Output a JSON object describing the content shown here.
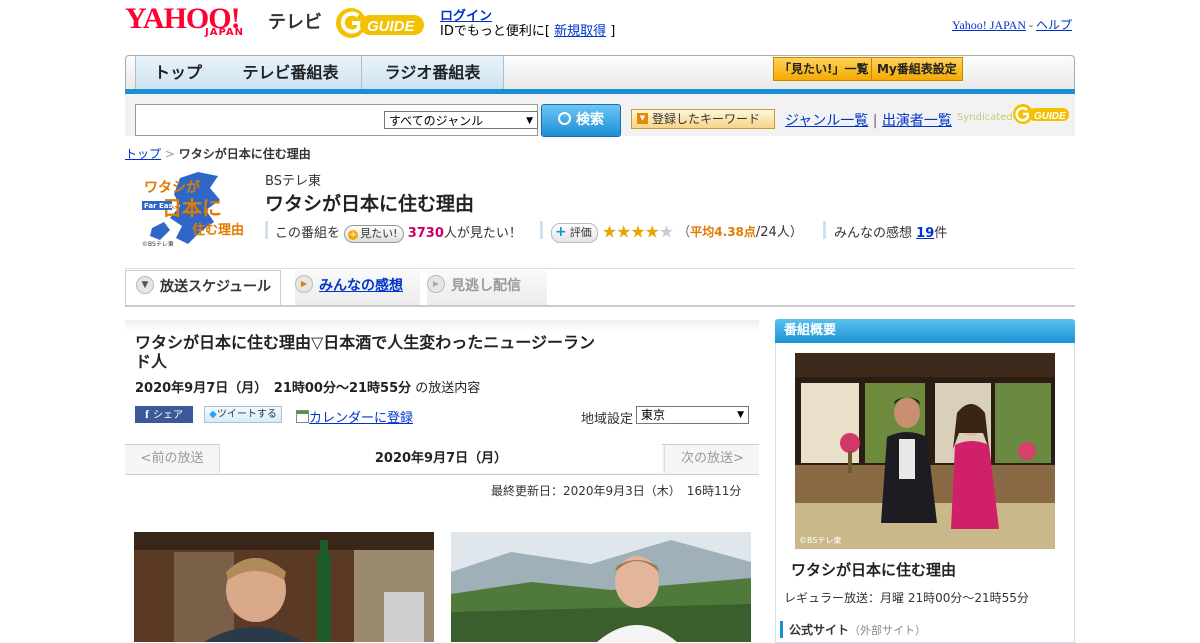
{
  "header": {
    "logo_yahoo": "YAHOO!",
    "logo_japan": "JAPAN",
    "logo_tv": "テレビ",
    "logo_gguide": "GUIDE",
    "login_link": "ログイン",
    "login_sub_prefix": "IDでもっと便利に[",
    "register_link": "新規取得",
    "login_sub_suffix": "]",
    "yahoo_japan_link": "Yahoo! JAPAN",
    "separator": "-",
    "help_link": "ヘルプ"
  },
  "nav": {
    "tabs": [
      "トップ",
      "テレビ番組表",
      "ラジオ番組表"
    ],
    "mitai_list": "「見たい!」一覧",
    "my_schedule": "My番組表設定"
  },
  "search": {
    "genre_selected": "すべてのジャンル",
    "search_button": "検索",
    "keyword_button": "登録したキーワード",
    "genre_list_link": "ジャンル一覧",
    "divider": "|",
    "performer_list_link": "出演者一覧",
    "syndicated": "Syndicated"
  },
  "breadcrumb": {
    "top": "トップ",
    "sep": ">",
    "current": "ワタシが日本に住む理由"
  },
  "program": {
    "logo_line1": "ワタシが",
    "logo_line2": "日本に",
    "logo_line3": "住む理由",
    "logo_far_east": "Far East",
    "logo_copyright": "©BSテレ東",
    "channel": "BSテレ東",
    "title": "ワタシが日本に住む理由",
    "want_prefix": "この番組を",
    "want_button": "見たい!",
    "want_count": "3730",
    "want_suffix": "人が見たい！",
    "rate_button": "評価",
    "rating_stars": 4.38,
    "rating_open": "（",
    "rating_avg": "平均4.38点",
    "rating_count": "/24人）",
    "impressions_prefix": "みんなの感想",
    "impressions_count": "19",
    "impressions_suffix": "件"
  },
  "tabs": {
    "schedule": "放送スケジュール",
    "impressions": "みんなの感想",
    "vod": "見逃し配信"
  },
  "episode": {
    "title": "ワタシが日本に住む理由▽日本酒で人生変わったニュージーランド人",
    "date": "2020年9月7日（月）　21時00分～21時55分",
    "date_suffix": "の放送内容",
    "fb_share": "シェア",
    "tweet": "ツイートする",
    "calendar": "カレンダーに登録",
    "region_label": "地域設定",
    "region_selected": "東京",
    "prev": "<前の放送",
    "current_date": "2020年9月7日（月）",
    "next": "次の放送>",
    "updated": "最終更新日：2020年9月3日（木）　16時11分"
  },
  "sidebar": {
    "heading": "番組概要",
    "photo_credit": "©BSテレ東",
    "title": "ワタシが日本に住む理由",
    "regular": "レギュラー放送：月曜 21時00分～21時55分",
    "official_site": "公式サイト",
    "external": "（外部サイト）"
  },
  "colors": {
    "accent_blue": "#1a8fd6",
    "yahoo_red": "#ff0033",
    "rating_orange": "#e07b00",
    "want_pink": "#cc0066"
  }
}
